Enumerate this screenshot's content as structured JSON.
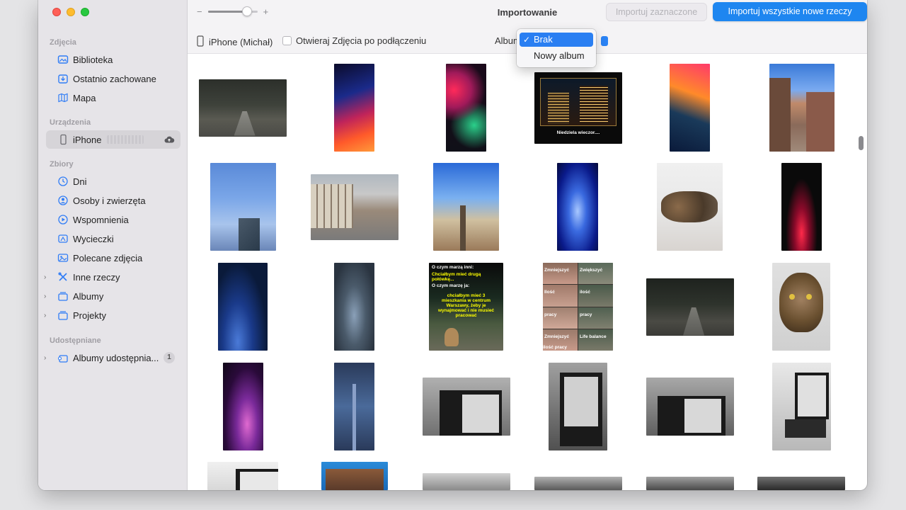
{
  "window": {
    "title": "Importowanie"
  },
  "toolbar": {
    "zoom_minus": "−",
    "zoom_plus": "+",
    "import_selected_label": "Importuj zaznaczone",
    "import_all_label": "Importuj wszystkie nowe rzeczy"
  },
  "subbar": {
    "device_name": "iPhone (Michał)",
    "open_photos_label": "Otwieraj Zdjęcia po podłączeniu",
    "album_label": "Album"
  },
  "album_dropdown": {
    "options": [
      "Brak",
      "Nowy album"
    ],
    "selected": "Brak"
  },
  "sidebar": {
    "sections": [
      {
        "title": "Zdjęcia"
      },
      {
        "title": "Urządzenia"
      },
      {
        "title": "Zbiory"
      },
      {
        "title": "Udostępniane"
      }
    ],
    "items": [
      {
        "label": "Biblioteka",
        "icon": "library-icon"
      },
      {
        "label": "Ostatnio zachowane",
        "icon": "recently-saved-icon"
      },
      {
        "label": "Mapa",
        "icon": "map-icon"
      },
      {
        "label": "iPhone",
        "icon": "iphone-icon"
      },
      {
        "label": "Dni",
        "icon": "clock-icon"
      },
      {
        "label": "Osoby i zwierzęta",
        "icon": "person-icon"
      },
      {
        "label": "Wspomnienia",
        "icon": "memories-icon"
      },
      {
        "label": "Wycieczki",
        "icon": "trips-icon"
      },
      {
        "label": "Polecane zdjęcia",
        "icon": "featured-photos-icon"
      },
      {
        "label": "Inne rzeczy",
        "icon": "utilities-icon"
      },
      {
        "label": "Albumy",
        "icon": "albums-icon"
      },
      {
        "label": "Projekty",
        "icon": "projects-icon"
      },
      {
        "label": "Albumy udostępnia...",
        "icon": "shared-albums-icon"
      }
    ],
    "shared_badge": "1"
  },
  "photos": {
    "captions": {
      "night_city": "Niedziela wieczor....",
      "meme_top": "O czym marzą inni:",
      "meme_line2": "Chciałbym mieć drugą połówkę...",
      "meme_line3": "O czym marzę ja:",
      "meme_line4": "chciałbym mieć 3 mieszkania w centrum Warszawy, żeby je wynajmować i nie musieć pracować",
      "meme2_1": "Zmniejszyć",
      "meme2_2": "Zwiększyć",
      "meme2_3": "Ilość",
      "meme2_4": "ilość",
      "meme2_5": "pracy",
      "meme2_6": "pracy",
      "meme2_7": "Zmniejszyć ilość pracy",
      "meme2_8": "Life balance"
    }
  },
  "colors": {
    "accent": "#1e86f0",
    "sidebar_bg": "#e6e4e8",
    "selected_item_bg": "#d6d4d8"
  }
}
